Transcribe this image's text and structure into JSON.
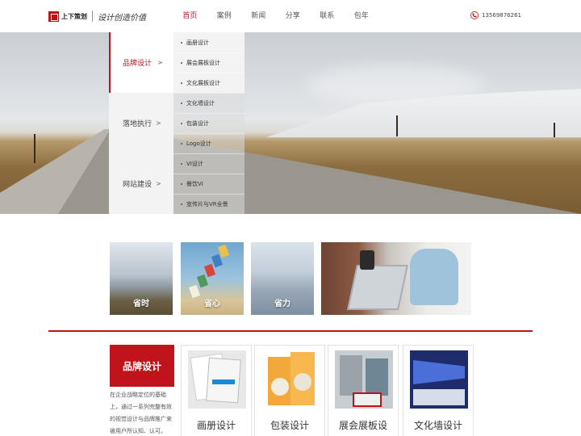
{
  "header": {
    "logo_name": "上下策划",
    "logo_slogan": "设计创造价值",
    "nav": [
      {
        "label": "首页",
        "active": true
      },
      {
        "label": "案例",
        "active": false
      },
      {
        "label": "新闻",
        "active": false
      },
      {
        "label": "分享",
        "active": false
      },
      {
        "label": "联系",
        "active": false
      },
      {
        "label": "包年",
        "active": false
      }
    ],
    "phone": "13569876261",
    "phone_icon": "phone-icon",
    "accent_color": "#c0141c"
  },
  "dropdown": {
    "categories": [
      {
        "label": "品牌设计",
        "arrow": ">",
        "active": true
      },
      {
        "label": "落地执行",
        "arrow": ">",
        "active": false
      },
      {
        "label": "网站建设",
        "arrow": ">",
        "active": false
      }
    ],
    "subitems": [
      "画册设计",
      "展会展板设计",
      "文化展板设计",
      "文化墙设计",
      "包装设计",
      "Logo设计",
      "VI设计",
      "餐饮VI",
      "宣传片与VR全景"
    ]
  },
  "features": [
    {
      "label": "省时"
    },
    {
      "label": "省心"
    },
    {
      "label": "省力"
    }
  ],
  "brand": {
    "title": "品牌设计",
    "description": "在企业战略定位的基础上，通过一系列完整有效的视觉设计与品牌推广来被用户所认知、认可。"
  },
  "cards": [
    {
      "title": "画册设计"
    },
    {
      "title": "包装设计"
    },
    {
      "title": "展会展板设"
    },
    {
      "title": "文化墙设计"
    }
  ]
}
